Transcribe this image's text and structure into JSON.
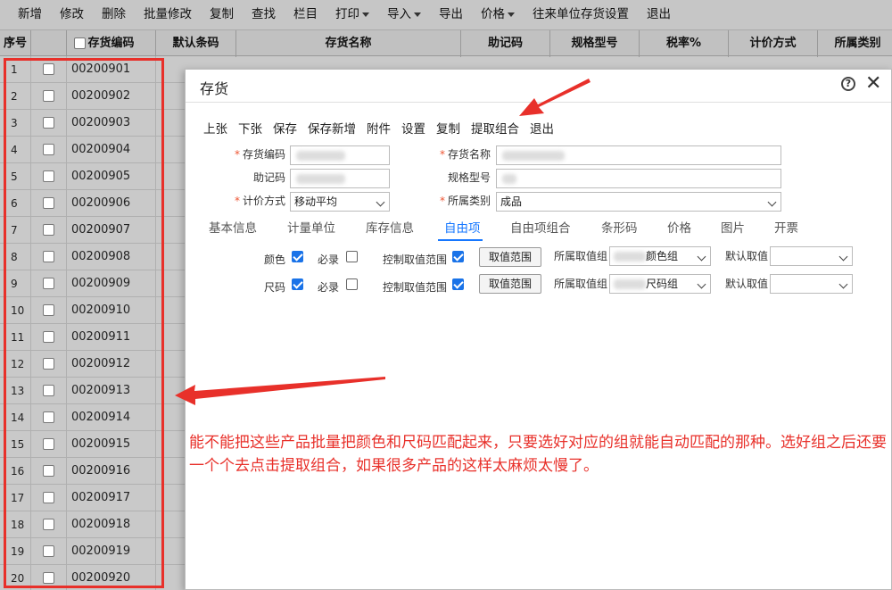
{
  "toolbar": {
    "items": [
      "新增",
      "修改",
      "删除",
      "批量修改",
      "复制",
      "查找",
      "栏目",
      "打印",
      "导入",
      "导出",
      "价格",
      "往来单位存货设置",
      "退出"
    ],
    "dropdown_flags": [
      false,
      false,
      false,
      false,
      false,
      false,
      false,
      true,
      true,
      false,
      true,
      false,
      false
    ]
  },
  "grid": {
    "headers": {
      "no": "序号",
      "code": "存货编码",
      "barcode": "默认条码",
      "name": "存货名称",
      "mnemonic": "助记码",
      "spec": "规格型号",
      "tax": "税率%",
      "pricing": "计价方式",
      "category": "所属类别"
    },
    "rows": [
      {
        "no": "1",
        "code": "00200901"
      },
      {
        "no": "2",
        "code": "00200902"
      },
      {
        "no": "3",
        "code": "00200903"
      },
      {
        "no": "4",
        "code": "00200904"
      },
      {
        "no": "5",
        "code": "00200905"
      },
      {
        "no": "6",
        "code": "00200906"
      },
      {
        "no": "7",
        "code": "00200907"
      },
      {
        "no": "8",
        "code": "00200908"
      },
      {
        "no": "9",
        "code": "00200909"
      },
      {
        "no": "10",
        "code": "00200910"
      },
      {
        "no": "11",
        "code": "00200911"
      },
      {
        "no": "12",
        "code": "00200912"
      },
      {
        "no": "13",
        "code": "00200913"
      },
      {
        "no": "14",
        "code": "00200914"
      },
      {
        "no": "15",
        "code": "00200915"
      },
      {
        "no": "16",
        "code": "00200916"
      },
      {
        "no": "17",
        "code": "00200917"
      },
      {
        "no": "18",
        "code": "00200918"
      },
      {
        "no": "19",
        "code": "00200919"
      },
      {
        "no": "20",
        "code": "00200920"
      }
    ]
  },
  "dialog": {
    "title": "存货",
    "help_glyph": "?",
    "close_glyph": "✕",
    "toolbar": [
      "上张",
      "下张",
      "保存",
      "保存新增",
      "附件",
      "设置",
      "复制",
      "提取组合",
      "退出"
    ],
    "fields": {
      "code_label": "存货编码",
      "name_label": "存货名称",
      "mnemonic_label": "助记码",
      "spec_label": "规格型号",
      "pricing_label": "计价方式",
      "pricing_value": "移动平均",
      "category_label": "所属类别",
      "category_value": "成品"
    },
    "tabs": [
      "基本信息",
      "计量单位",
      "库存信息",
      "自由项",
      "自由项组合",
      "条形码",
      "价格",
      "图片",
      "开票"
    ],
    "active_tab": "自由项",
    "free_items": [
      {
        "name": "颜色",
        "name_checked": true,
        "required_label": "必录",
        "required_checked": false,
        "control_label": "控制取值范围",
        "control_checked": true,
        "range_button": "取值范围",
        "group_label": "所属取值组",
        "group_value": "颜色组",
        "default_label": "默认取值",
        "default_value": ""
      },
      {
        "name": "尺码",
        "name_checked": true,
        "required_label": "必录",
        "required_checked": false,
        "control_label": "控制取值范围",
        "control_checked": true,
        "range_button": "取值范围",
        "group_label": "所属取值组",
        "group_value": "尺码组",
        "default_label": "默认取值",
        "default_value": ""
      }
    ]
  },
  "annotation": {
    "text": "能不能把这些产品批量把颜色和尺码匹配起来，只要选好对应的组就能自动匹配的那种。选好组之后还要一个个去点击提取组合，如果很多产品的这样太麻烦太慢了。",
    "color": "#e8302a"
  },
  "colors": {
    "background": "#c9c9c9",
    "active_tab": "#1677ff",
    "checkbox_on": "#1a73e8"
  }
}
